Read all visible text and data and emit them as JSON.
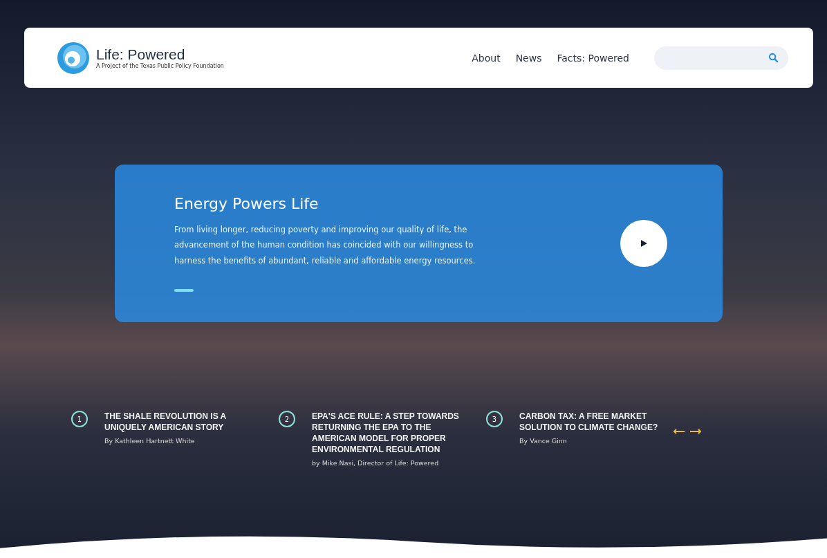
{
  "logo": {
    "name": "Life: Powered",
    "tagline": "A Project of the Texas Public Policy Foundation"
  },
  "nav": [
    {
      "label": "About"
    },
    {
      "label": "News"
    },
    {
      "label": "Facts: Powered"
    }
  ],
  "search": {
    "kind": "pill"
  },
  "hero": {
    "title": "Energy Powers Life",
    "text": "From living longer, reducing poverty and improving our quality of life, the advancement of the human condition has coincided with our willingness to harness the benefits of abundant, reliable and affordable energy resources.",
    "slides": [
      {
        "selected": true
      }
    ]
  },
  "stories": [
    {
      "number": "1",
      "title": "THE SHALE REVOLUTION IS A UNIQUELY AMERICAN STORY",
      "byline": "By Kathleen Hartnett White"
    },
    {
      "number": "2",
      "title": "EPA'S ACE RULE: A STEP TOWARDS RETURNING THE EPA TO THE AMERICAN MODEL FOR PROPER ENVIRONMENTAL REGULATION",
      "byline": "by Mike Nasi, Director of Life: Powered"
    },
    {
      "number": "3",
      "title": "CARBON TAX: A FREE MARKET SOLUTION TO CLIMATE CHANGE?",
      "byline": "By Vance Ginn"
    }
  ]
}
